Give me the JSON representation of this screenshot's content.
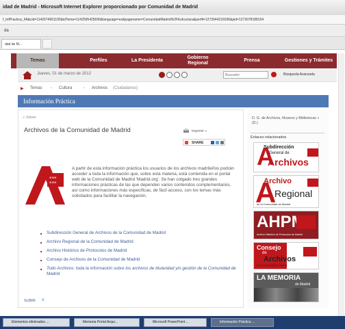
{
  "window": {
    "title": "idad de Madrid - Microsoft Internet Explorer proporcionado por Comunidad de Madrid",
    "address": "f_InfPractica_FA&cid=1142674951195&idTema=1142595425690&language=es&pagename=ComunidadMadrid%2FEstructura&perfil=1273044216036&pid=1273078188154",
    "menu_label": "da",
    "tab_label": "dad de M..."
  },
  "nav": {
    "items": [
      "Temas",
      "Perfiles",
      "La Presidenta",
      "Gobierno Regional",
      "Prensa",
      "Gestiones y Trámites"
    ]
  },
  "date_row": {
    "date": "Jueves, 01 de marzo de 2012",
    "search_placeholder": "Buscador",
    "advanced_search": "Búsqueda Avanzada"
  },
  "breadcrumb": {
    "items": [
      "Temas",
      "Cultura",
      "Archivos"
    ],
    "suffix": "(Ciudadanos)"
  },
  "section_title": "Información Práctica",
  "content": {
    "back": "« Volver",
    "heading": "Archivos de la Comunidad de Madrid",
    "print": "Imprimir »",
    "share": "SHARE",
    "body": "A partir de esta información práctica los usuarios de los archivos madrileños podrán acceder a toda la información que, sobre esta materia, está contenida en el portal web de la Comunidad de Madrid 'Madrid.org'. Se han colgado tres grandes informaciones prácticas de las que dependen varios contenidos complementarios, así como informaciones más específicas, de fácil acceso, con los temas más solicitados para facilitar la navegación.",
    "links": [
      "Subdirección General de Archivos de la Comunidad de Madrid",
      "Archivo Regional de la Comunidad de Madrid",
      "Archivo Histórico de Protocolos de Madrid",
      "Consejo de Archivos de la Comunidad de Madrid",
      "Todo Archivos: toda la información sobre los archivos de titularidad y/o gestión de la Comunidad de Madrid"
    ],
    "subir": "SUBIR"
  },
  "right": {
    "top_link": "D. G. de Archivos, Museos y Bibliotecas » (D.)",
    "related_title": "Enlaces relacionados",
    "banners": [
      {
        "line1": "Subdirección",
        "line2": "General de",
        "line3": "Archivos"
      },
      {
        "line1": "Archivo",
        "line2": "Regional",
        "line3": "de la Comunidad de Madrid"
      },
      {
        "line1": "AHPM",
        "line2": "Archivo Histórico de Protocolos de Madrid"
      },
      {
        "line1": "Consejo",
        "line2": "de",
        "line3": "Archivos",
        "line4": "de la Comunidad de Madrid"
      },
      {
        "line1": "LA MEMORIA",
        "line2": "de Madrid"
      }
    ]
  },
  "taskbar": {
    "items": [
      "Elementos eliminados ...",
      "Memoria Portal Arqui...",
      "Microsoft PowerPoint ...",
      "Información Práctica ..."
    ]
  },
  "colors": {
    "brand_red": "#8b2a2f",
    "section_blue": "#4f79b4",
    "link_blue": "#3c5e97"
  }
}
